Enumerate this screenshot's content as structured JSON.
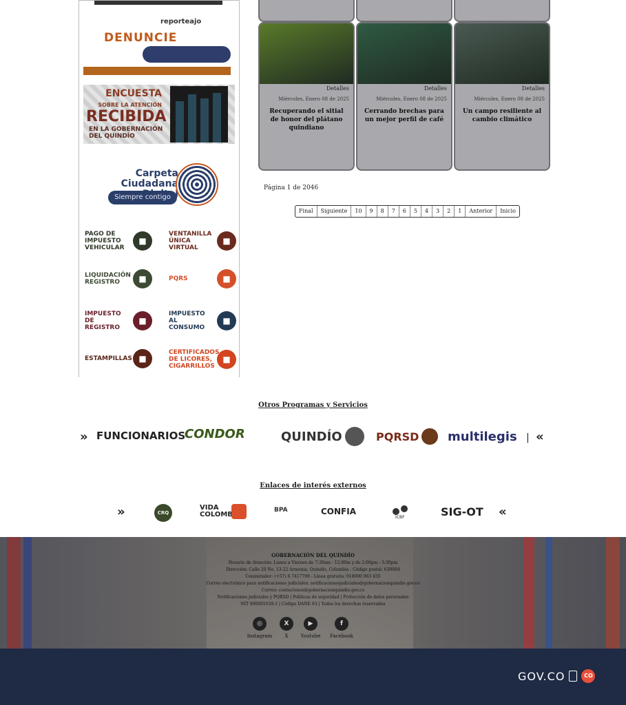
{
  "sidebar": {
    "denuncia": {
      "brand": "reporteajo",
      "title": "DENUNCIE"
    },
    "encuesta": {
      "line1": "ENCUESTA",
      "line2": "SOBRE LA ATENCIÓN",
      "big": "RECIBIDA",
      "sub": "EN LA GOBERNACIÓN DEL QUINDÍO"
    },
    "carpeta": {
      "title": "Carpeta Ciudadana Digital",
      "pill": "Siempre contigo"
    },
    "services": [
      {
        "label": "PAGO DE IMPUESTO VEHICULAR",
        "icon": "car-icon",
        "color": "#2f3a2a"
      },
      {
        "label": "VENTANILLA ÚNICA VIRTUAL",
        "icon": "monitor-icon",
        "color": "#6b2a1e"
      },
      {
        "label": "LIQUIDACIÓN REGISTRO",
        "icon": "globe-icon",
        "color": "#3d4a34"
      },
      {
        "label": "PQRS",
        "icon": "chat-icon",
        "color": "#d4502a"
      },
      {
        "label": "IMPUESTO DE REGISTRO",
        "icon": "document-icon",
        "color": "#6a1e2a"
      },
      {
        "label": "IMPUESTO AL CONSUMO",
        "icon": "coin-icon",
        "color": "#233a55"
      },
      {
        "label": "ESTAMPILLAS",
        "icon": "stamp-icon",
        "color": "#5a2418"
      },
      {
        "label": "CERTIFICADOS DE LICORES, CIGARRILLOS",
        "icon": "certificate-icon",
        "color": "#d2451f"
      }
    ]
  },
  "news": [
    {
      "detail": "Detalles",
      "date": "Miércoles, Enero 08 de 2025",
      "title": "Un campo resiliente al cambio climático",
      "photo": "#4a5a52"
    },
    {
      "detail": "Detalles",
      "date": "Miércoles, Enero 08 de 2025",
      "title": "Cerrando brechas para un mejor perfil de café",
      "photo": "#2f5a42"
    },
    {
      "detail": "Detalles",
      "date": "Miércoles, Enero 08 de 2025",
      "title": "Recuperando el sitial de honor del plátano quindiano",
      "photo": "#5a7a2a"
    }
  ],
  "pagination": {
    "info": "Página 1 de 2046",
    "items": [
      "Inicio",
      "Anterior",
      "1",
      "2",
      "3",
      "4",
      "5",
      "6",
      "7",
      "8",
      "9",
      "10",
      "Siguiente",
      "Final"
    ]
  },
  "programas": {
    "title": "Otros Programas y Servicios",
    "logos": [
      "multilegis",
      "PQRSD",
      "QUINDÍO",
      "CONDOR",
      "FUNCIONARIOS"
    ],
    "prev": "«",
    "next": "»",
    "sep": "|"
  },
  "enlaces": {
    "title": "Enlaces de interés externos",
    "logos": [
      "SIG-OT",
      "ICBF",
      "CONFIA",
      "BPA",
      "VIDA COLOMBIA",
      "CRQ"
    ],
    "prev": "«",
    "next": "»"
  },
  "footer": {
    "title": "GOBERNACIÓN DEL QUINDÍO",
    "lines": [
      "Horario de Atención: Lunes a Viernes de 7:30am - 12:00m y de 2:00pm - 5:30pm",
      "Dirección: Calle 20 No. 13-22 Armenia, Quindío, Colombia - Código postal: 630004",
      "Conmutador: (+57) 6 7417700 - Línea gratuita: 018000 963 455",
      "Correo electrónico para notificaciones judiciales: notificacionesjudiciales@gobernacionquindio.gov.co",
      "Correo: contactenos@gobernacionquindio.gov.co",
      "Notificaciones judiciales y PQRSD | Políticas de seguridad | Protección de datos personales",
      "NIT 890001639-1 | Código DANE 63 | Todos los derechos reservados"
    ],
    "social": [
      {
        "label": "Facebook",
        "icon": "facebook-icon",
        "glyph": "f"
      },
      {
        "label": "Youtube",
        "icon": "youtube-icon",
        "glyph": "▶"
      },
      {
        "label": "X",
        "icon": "x-icon",
        "glyph": "X"
      },
      {
        "label": "Instagram",
        "icon": "instagram-icon",
        "glyph": "◎"
      }
    ]
  },
  "govbar": {
    "text": "GOV.CO",
    "badge": "CO"
  }
}
